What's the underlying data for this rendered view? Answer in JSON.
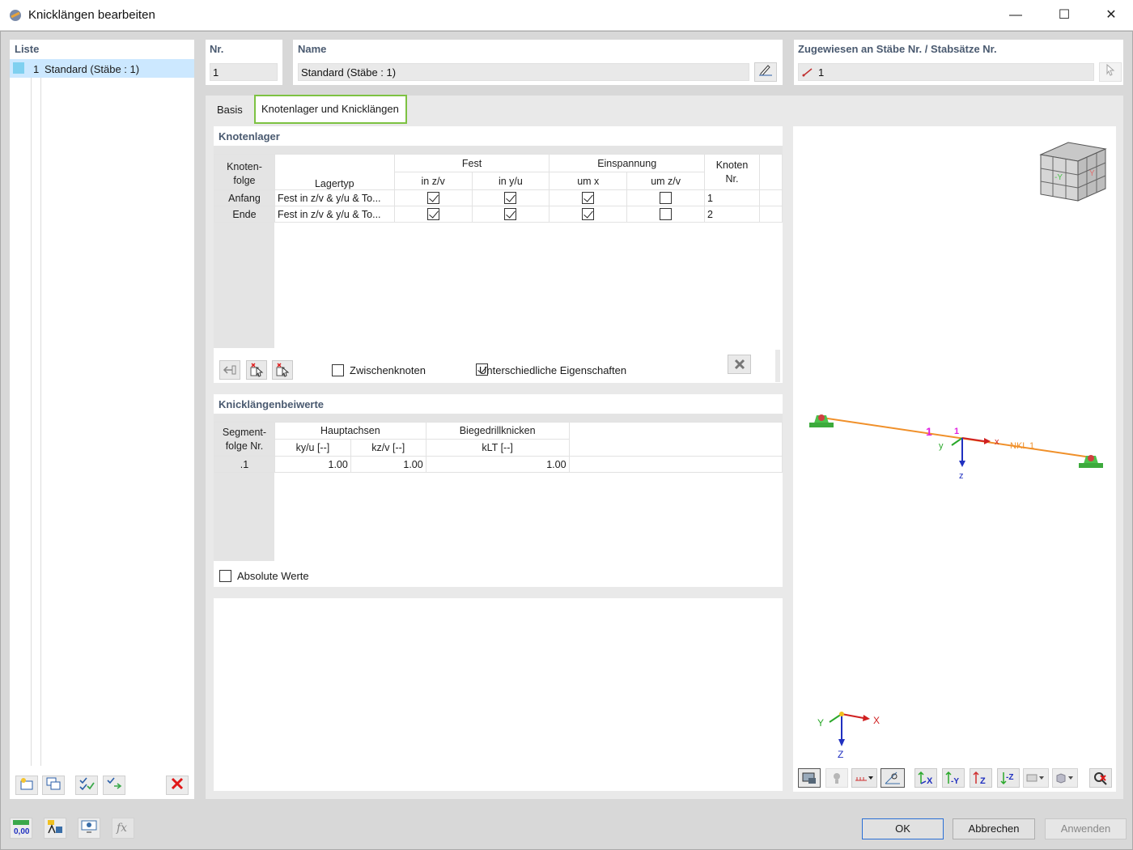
{
  "window": {
    "title": "Knicklängen bearbeiten",
    "minimize": "—",
    "maximize": "☐",
    "close": "✕"
  },
  "list": {
    "header": "Liste",
    "items": [
      {
        "num": "1",
        "label": "Standard (Stäbe : 1)",
        "color": "#7fd0f0"
      }
    ]
  },
  "nr": {
    "label": "Nr.",
    "value": "1"
  },
  "name": {
    "label": "Name",
    "value": "Standard (Stäbe : 1)"
  },
  "assigned": {
    "label": "Zugewiesen an Stäbe Nr. / Stabsätze Nr.",
    "value": "1"
  },
  "tabs": [
    {
      "label": "Basis",
      "active": false
    },
    {
      "label": "Knotenlager und Knicklängen",
      "active": true
    }
  ],
  "knotenlager": {
    "title": "Knotenlager",
    "col_group_fest": "Fest",
    "col_group_einspannung": "Einspannung",
    "h_knotenfolge_1": "Knoten-",
    "h_knotenfolge_2": "folge",
    "h_lagertyp": "Lagertyp",
    "h_in_zv": "in z/v",
    "h_in_yu": "in y/u",
    "h_um_x": "um x",
    "h_um_zv": "um z/v",
    "h_knoten_1": "Knoten",
    "h_knoten_2": "Nr.",
    "rows": [
      {
        "seq": "Anfang",
        "type": "Fest in z/v & y/u & To...",
        "in_zv": true,
        "in_yu": true,
        "um_x": true,
        "um_zv": false,
        "node": "1"
      },
      {
        "seq": "Ende",
        "type": "Fest in z/v & y/u & To...",
        "in_zv": true,
        "in_yu": true,
        "um_x": true,
        "um_zv": false,
        "node": "2"
      }
    ],
    "zwischenknoten": {
      "label": "Zwischenknoten",
      "checked": false
    },
    "unterschiedliche": {
      "label": "Unterschiedliche Eigenschaften",
      "checked": true
    }
  },
  "knicklaengen": {
    "title": "Knicklängenbeiwerte",
    "h_segment_1": "Segment-",
    "h_segment_2": "folge Nr.",
    "h_hauptachsen": "Hauptachsen",
    "h_biege": "Biegedrillknicken",
    "h_kyu": "ky/u [--]",
    "h_kzv": "kz/v [--]",
    "h_klt": "kLT [--]",
    "rows": [
      {
        "seg": ".1",
        "kyu": "1.00",
        "kzv": "1.00",
        "klt": "1.00"
      }
    ],
    "absolute": {
      "label": "Absolute Werte",
      "checked": false
    }
  },
  "view": {
    "member_label": "NKL 1",
    "member_num": "1",
    "local_axes": {
      "x": "x",
      "y": "y",
      "z": "z"
    },
    "global_axes": {
      "x": "X",
      "y": "Y",
      "z": "Z"
    },
    "cube_labels": {
      "neg_y": "-Y",
      "y": "Y"
    },
    "toolbar": [
      "display-icon",
      "render-icon",
      "units-dropdown",
      "view-settings-icon",
      "view-x-icon",
      "view-neg-y-icon",
      "view-z-icon",
      "view-neg-z-icon",
      "visibility-dropdown",
      "cube-dropdown",
      "reset-view-icon"
    ],
    "toolbar_text": {
      "view_x": "X",
      "view_neg_y": "-Y",
      "view_z": "Z",
      "view_neg_z": "-Z"
    }
  },
  "bottom": {
    "units_value": "0,00",
    "ok": "OK",
    "cancel": "Abbrechen",
    "apply": "Anwenden"
  },
  "colors": {
    "accent_green": "#7dc242",
    "member_orange": "#f0902a",
    "support_green": "#4cc24c",
    "selection_blue": "#cce8ff"
  }
}
